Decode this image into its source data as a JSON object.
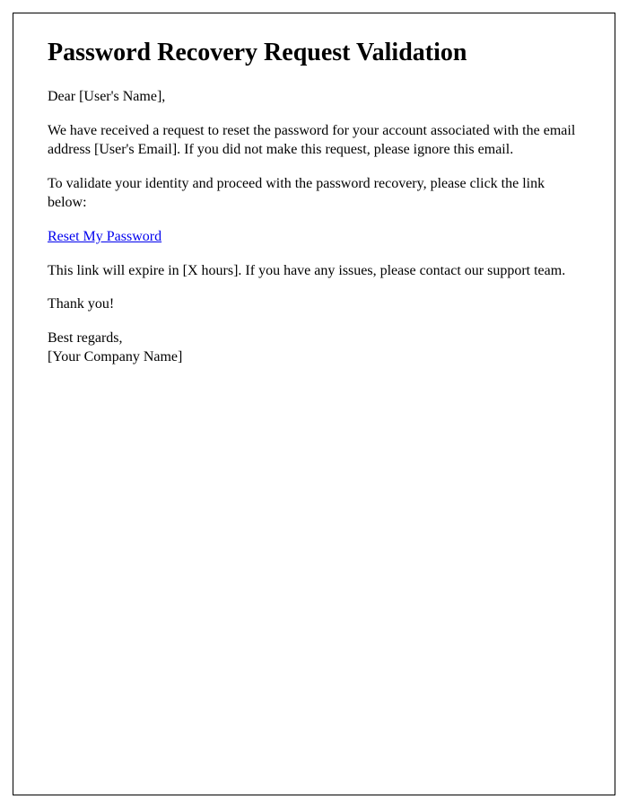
{
  "title": "Password Recovery Request Validation",
  "greeting": "Dear [User's Name],",
  "paragraph1": "We have received a request to reset the password for your account associated with the email address [User's Email]. If you did not make this request, please ignore this email.",
  "paragraph2": "To validate your identity and proceed with the password recovery, please click the link below:",
  "link_text": "Reset My Password",
  "paragraph3": "This link will expire in [X hours]. If you have any issues, please contact our support team.",
  "thankyou": "Thank you!",
  "regards": "Best regards,",
  "company": "[Your Company Name]"
}
